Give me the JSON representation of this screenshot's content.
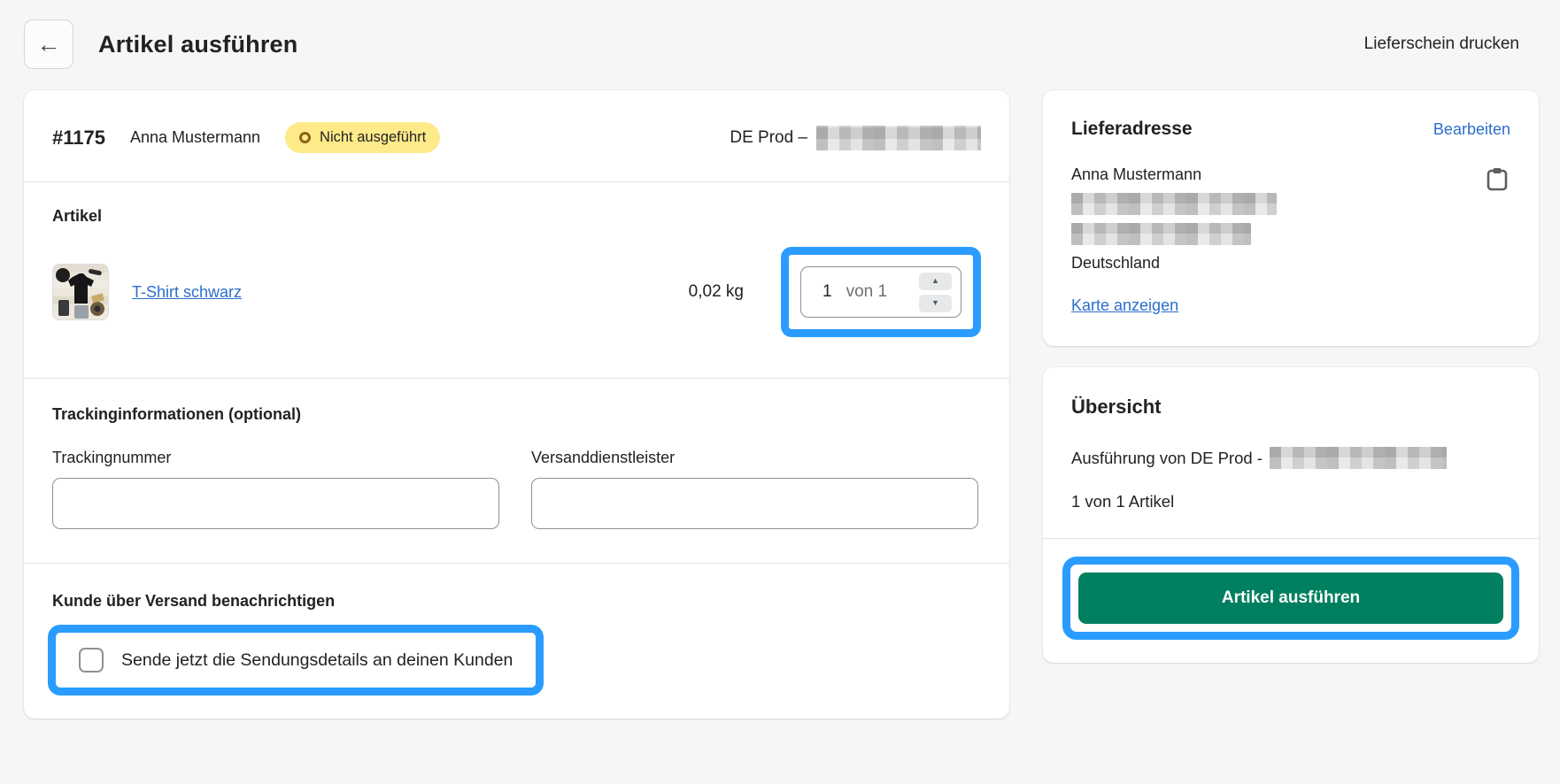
{
  "page": {
    "title": "Artikel ausführen",
    "print_link": "Lieferschein drucken",
    "back_arrow": "←"
  },
  "order": {
    "number": "#1175",
    "customer": "Anna Mustermann",
    "status_badge": "Nicht ausgeführt",
    "location_label": "DE Prod –"
  },
  "items_section": {
    "heading": "Artikel",
    "product": {
      "title": "T-Shirt schwarz",
      "weight": "0,02 kg",
      "quantity": "1",
      "quantity_suffix": "von 1",
      "spin_up": "▲",
      "spin_down": "▼"
    }
  },
  "tracking_section": {
    "heading": "Trackinginformationen (optional)",
    "tracking_number_label": "Trackingnummer",
    "tracking_number_value": "",
    "carrier_label": "Versanddienstleister",
    "carrier_value": ""
  },
  "notify_section": {
    "heading": "Kunde über Versand benachrichtigen",
    "checkbox_label": "Sende jetzt die Sendungsdetails an deinen Kunden"
  },
  "shipping_address": {
    "heading": "Lieferadresse",
    "edit_link": "Bearbeiten",
    "name": "Anna Mustermann",
    "country": "Deutschland",
    "map_link": "Karte anzeigen"
  },
  "summary": {
    "heading": "Übersicht",
    "fulfillment_label": "Ausführung von DE Prod -",
    "items_count": "1 von 1 Artikel",
    "submit_label": "Artikel ausführen"
  },
  "colors": {
    "highlight_blue": "#2b9cff",
    "badge_yellow": "#ffea8a",
    "badge_icon": "#8a6116",
    "success_green": "#008060",
    "link_blue": "#2c6ecb",
    "text": "#202223",
    "muted_text": "#6d7175",
    "page_background": "#f6f6f7"
  }
}
